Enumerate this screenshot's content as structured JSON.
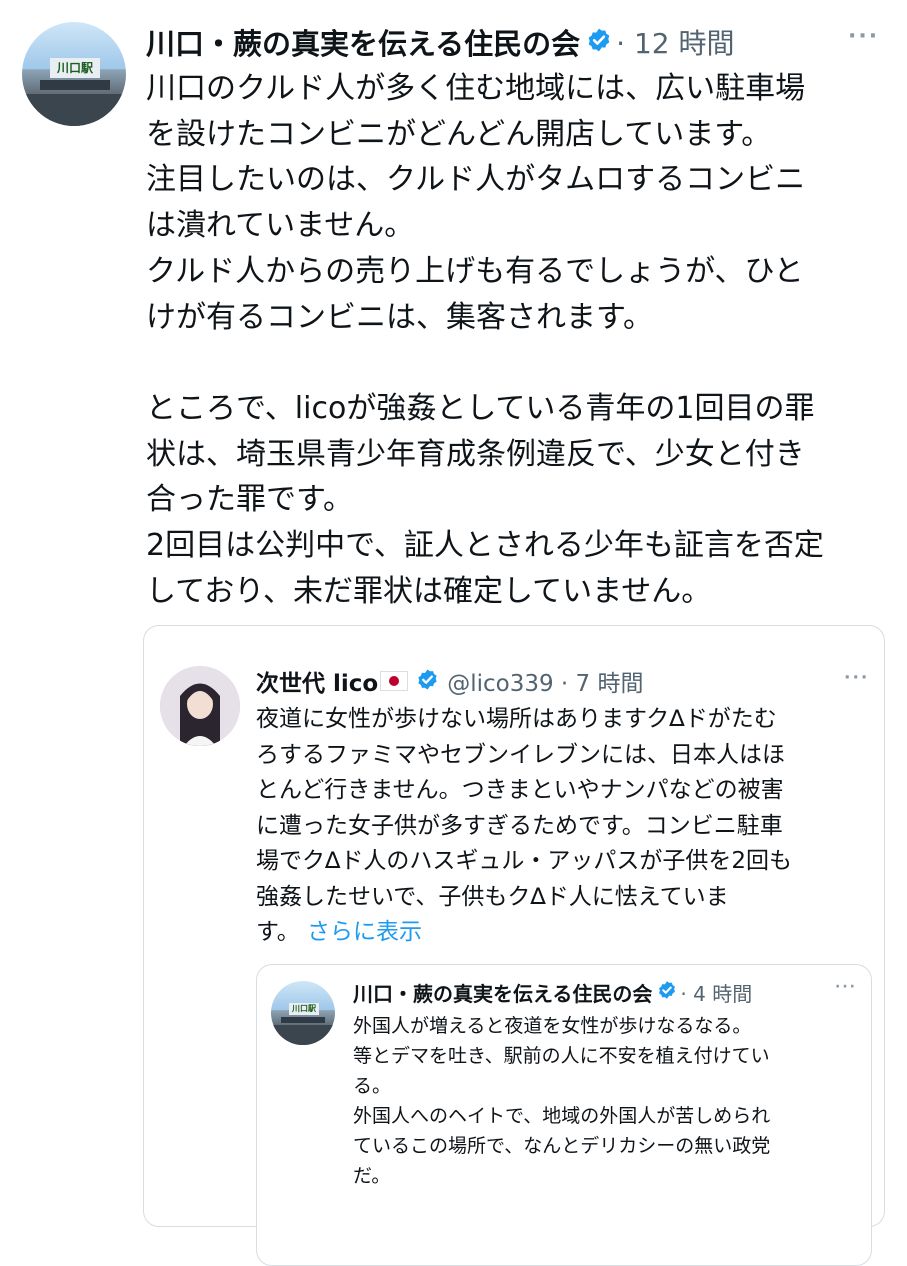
{
  "main": {
    "author_name": "川口・蕨の真実を伝える住民の会",
    "meta": "· 12 時間",
    "body": "川口のクルド人が多く住む地域には、広い駐車場\nを設けたコンビニがどんどん開店しています。\n注目したいのは、クルド人がタムロするコンビニ\nは潰れていません。\nクルド人からの売り上げも有るでしょうが、ひと\nけが有るコンビニは、集客されます。\n\nところで、licoが強姦としている青年の1回目の罪\n状は、埼玉県青少年育成条例違反で、少女と付き\n合った罪です。\n2回目は公判中で、証人とされる少年も証言を否定\nしており、未だ罪状は確定していません。",
    "more_icon": "more-dots-icon"
  },
  "quote": {
    "author_name": "次世代 lico",
    "handle_time": "@lico339 · 7 時間",
    "body": "夜道に女性が歩けない場所はありますク∆ドがたむ\nろするファミマやセブンイレブンには、日本人はほ\nとんど行きません。つきまといやナンパなどの被害\nに遭った女子供が多すぎるためです。コンビニ駐車\n場でク∆ド人のハスギュル・アッパスが子供を2回も\n強姦したせいで、子供もク∆ド人に怯えていま\nす。",
    "show_more": "さらに表示"
  },
  "nested_quote": {
    "author_name": "川口・蕨の真実を伝える住民の会",
    "meta": "· 4 時間",
    "body": "外国人が増えると夜道を女性が歩けなるなる。\n等とデマを吐き、駅前の人に不安を植え付けてい\nる。\n外国人へのヘイトで、地域の外国人が苦しめられ\nているこの場所で、なんとデリカシーの無い政党\nだ。"
  },
  "avatar_sign": "川口駅",
  "colors": {
    "verified": "#1d9bf0",
    "link": "#1d9bf0",
    "meta": "#536471"
  }
}
